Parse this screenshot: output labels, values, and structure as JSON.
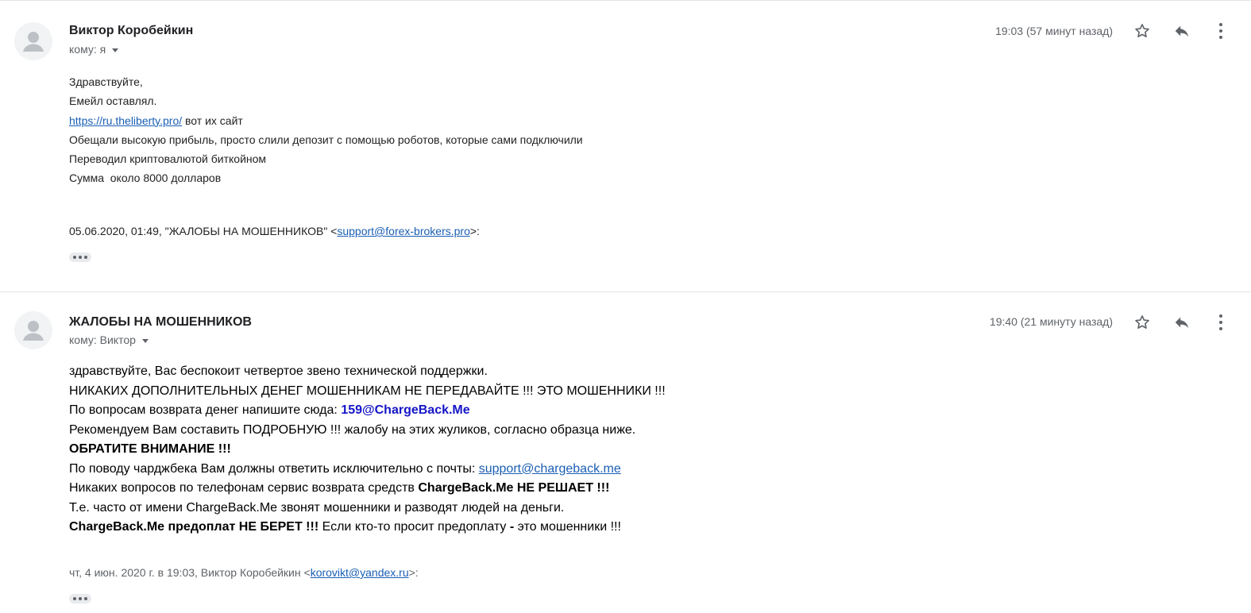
{
  "messages": [
    {
      "sender": "Виктор Коробейкин",
      "to": "кому: я",
      "time": "19:03 (57 минут назад)",
      "body": {
        "line1": "Здравствуйте,",
        "line2": "Емейл оставлял.",
        "line3_link": "https://ru.theliberty.pro/",
        "line3_rest": " вот их сайт",
        "line4": "Обещали высокую прибыль, просто слили депозит с помощью роботов, которые сами подключили",
        "line5": "Переводил криптовалютой биткойном",
        "line6": "Сумма  около 8000 долларов"
      },
      "quote": {
        "prefix": "05.06.2020, 01:49, \"ЖАЛОБЫ НА МОШЕННИКОВ\" <",
        "email": "support@forex-brokers.pro",
        "suffix": ">:"
      }
    },
    {
      "sender": "ЖАЛОБЫ НА МОШЕННИКОВ",
      "to": "кому: Виктор",
      "time": "19:40 (21 минуту назад)",
      "body": {
        "line1": "здравствуйте, Вас беспокоит четвертое звено технической поддержки.",
        "line2": "НИКАКИХ ДОПОЛНИТЕЛЬНЫХ ДЕНЕГ МОШЕННИКАМ НЕ ПЕРЕДАВАЙТЕ !!! ЭТО МОШЕННИКИ !!!",
        "line3_a": "По вопросам возврата денег напишите сюда: ",
        "line3_b": "159@ChargeBack.Me",
        "line4": "Рекомендуем Вам составить ПОДРОБНУЮ !!! жалобу на этих жуликов, согласно образца ниже.",
        "line5": "ОБРАТИТЕ ВНИМАНИЕ !!!",
        "line6_a": "По поводу чарджбека Вам должны ответить исключительно с почты: ",
        "line6_link": "support@chargeback.me",
        "line7_a": "Никаких вопросов по телефонам сервис возврата средств ",
        "line7_b": "ChargeBack.Me НЕ РЕШАЕТ !!!",
        "line8": "Т.е. часто от имени ChargeBack.Me звонят мошенники и разводят людей на деньги.",
        "line9_a": "ChargeBack.Me предоплат НЕ БЕРЕТ !!!",
        "line9_b": " Если кто-то просит предоплату ",
        "line9_c": "-",
        "line9_d": " это мошенники !!!"
      },
      "quote": {
        "prefix": "чт, 4 июн. 2020 г. в 19:03, Виктор Коробейкин <",
        "email": "korovikt@yandex.ru",
        "suffix": ">:"
      }
    }
  ],
  "icons": {
    "avatar": "person-avatar-icon",
    "star": "star-icon",
    "reply": "reply-icon",
    "more": "more-vert-icon",
    "expand": "ellipsis-icon"
  },
  "colors": {
    "link": "#1a5fb4",
    "accent_bold_blue": "#1515c8",
    "meta_gray": "#5f6368"
  }
}
